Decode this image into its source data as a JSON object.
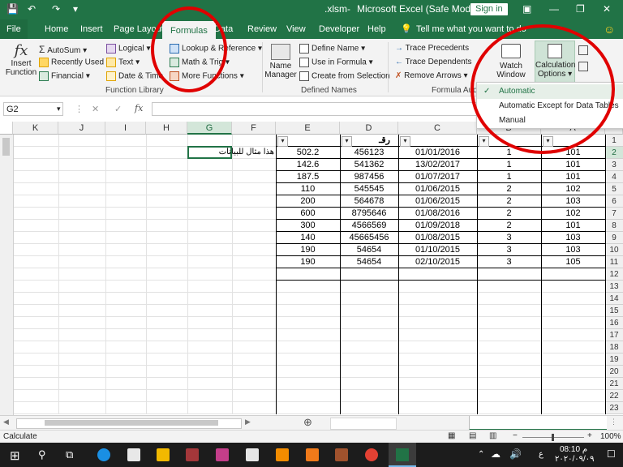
{
  "titlebar": {
    "filename": ".xlsm",
    "app_title": "Microsoft Excel (Safe Mode)",
    "signin": "Sign in"
  },
  "tabs": [
    "File",
    "Home",
    "Insert",
    "Page Layout",
    "Formulas",
    "Data",
    "Review",
    "View",
    "Developer",
    "Help"
  ],
  "tell_me": "Tell me what you want to do",
  "ribbon": {
    "insert_function": [
      "Insert",
      "Function"
    ],
    "autosum": "AutoSum",
    "recently_used": "Recently Used",
    "financial": "Financial",
    "logical": "Logical",
    "text": "Text",
    "date_time": "Date & Time",
    "lookup": "Lookup & Reference",
    "math": "Math & Trig",
    "more": "More Functions",
    "function_library": "Function Library",
    "name_manager": [
      "Name",
      "Manager"
    ],
    "define_name": "Define Name",
    "use_in_formula": "Use in Formula",
    "create_from_selection": "Create from Selection",
    "defined_names": "Defined Names",
    "trace_precedents": "Trace Precedents",
    "trace_dependents": "Trace Dependents",
    "remove_arrows": "Remove Arrows",
    "formula_auditing": "Formula Auditi",
    "watch_window": [
      "Watch",
      "Window"
    ],
    "calc_options": [
      "Calculation",
      "Options"
    ]
  },
  "dropdown": [
    "Automatic",
    "Automatic Except for Data Tables",
    "Manual"
  ],
  "namebox": "G2",
  "fx_symbol": "fx",
  "columns": [
    "K",
    "J",
    "I",
    "H",
    "G",
    "F",
    "E",
    "D",
    "C",
    "B",
    "A"
  ],
  "rows": [
    "1",
    "2",
    "3",
    "4",
    "5",
    "6",
    "7",
    "8",
    "9",
    "10",
    "11",
    "12",
    "13",
    "14",
    "15",
    "16",
    "17",
    "18",
    "19",
    "20",
    "21",
    "22",
    "23"
  ],
  "header_row": {
    "D": "رقـ"
  },
  "g2_text": "هذا مثال للبيانات المطلوبة",
  "table": [
    {
      "E": "502.2",
      "D": "456123",
      "C": "01/01/2016",
      "B": "1",
      "A": "101"
    },
    {
      "E": "142.6",
      "D": "541362",
      "C": "13/02/2017",
      "B": "1",
      "A": "101"
    },
    {
      "E": "187.5",
      "D": "987456",
      "C": "01/07/2017",
      "B": "1",
      "A": "101"
    },
    {
      "E": "110",
      "D": "545545",
      "C": "01/06/2015",
      "B": "2",
      "A": "102"
    },
    {
      "E": "200",
      "D": "564678",
      "C": "01/06/2015",
      "B": "2",
      "A": "103"
    },
    {
      "E": "600",
      "D": "8795646",
      "C": "01/08/2016",
      "B": "2",
      "A": "102"
    },
    {
      "E": "300",
      "D": "4566569",
      "C": "01/09/2018",
      "B": "2",
      "A": "101"
    },
    {
      "E": "140",
      "D": "45665456",
      "C": "01/08/2015",
      "B": "3",
      "A": "103"
    },
    {
      "E": "190",
      "D": "54654",
      "C": "01/10/2015",
      "B": "3",
      "A": "103"
    },
    {
      "E": "190",
      "D": "54654",
      "C": "02/10/2015",
      "B": "3",
      "A": "105"
    }
  ],
  "status": {
    "left": "Calculate",
    "zoom": "100%"
  },
  "clock": {
    "time": "08:10 م",
    "date": "٢٠٢٠/٠٩/٠٩",
    "lang": "ع"
  },
  "colors": {
    "excel_green": "#217346",
    "circle_red": "#e00000"
  }
}
